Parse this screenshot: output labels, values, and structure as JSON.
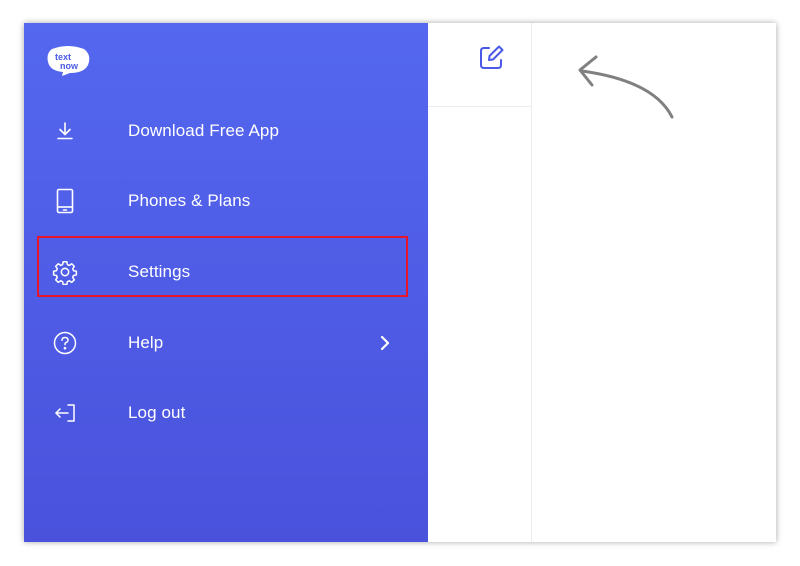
{
  "brand": {
    "logo_icon": "textnow-logo-icon",
    "logo_text": "text now"
  },
  "menu": {
    "items": [
      {
        "label": "Download Free App",
        "icon": "download-icon"
      },
      {
        "label": "Phones & Plans",
        "icon": "phone-icon"
      },
      {
        "label": "Settings",
        "icon": "gear-icon",
        "highlighted": true
      },
      {
        "label": "Help",
        "icon": "help-circle-icon",
        "has_submenu": true
      },
      {
        "label": "Log out",
        "icon": "logout-icon"
      }
    ]
  },
  "toolbar": {
    "compose_icon": "compose-icon"
  },
  "colors": {
    "drawer_top": "#5467ef",
    "drawer_bottom": "#4a52dc",
    "accent": "#4a5ae6",
    "highlight_border": "#e8162a",
    "arrow": "#808080"
  }
}
